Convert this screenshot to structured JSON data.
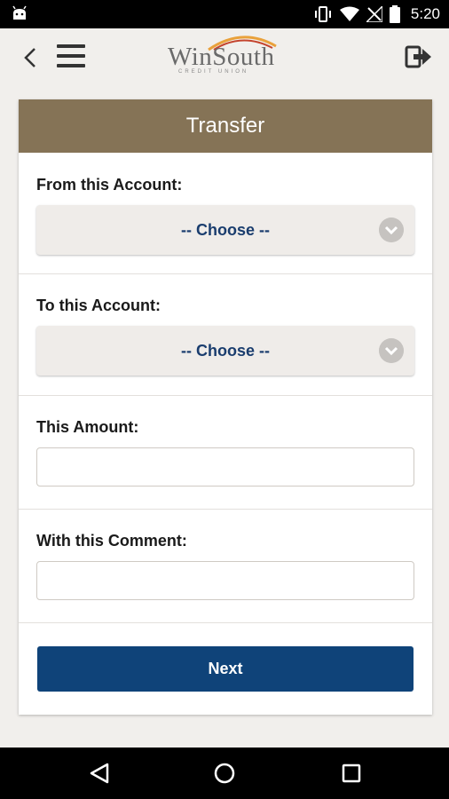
{
  "status_bar": {
    "time": "5:20",
    "icons": [
      "android-debug-icon",
      "vibrate-icon",
      "wifi-icon",
      "no-signal-icon",
      "battery-icon"
    ]
  },
  "app_bar": {
    "logo_text": "WinSouth",
    "logo_subtext": "CREDIT UNION",
    "icons": [
      "back-icon",
      "menu-icon",
      "logout-icon"
    ]
  },
  "transfer": {
    "title": "Transfer",
    "from_label": "From this Account:",
    "from_value": "-- Choose --",
    "to_label": "To this Account:",
    "to_value": "-- Choose --",
    "amount_label": "This Amount:",
    "amount_value": "",
    "comment_label": "With this Comment:",
    "comment_value": "",
    "next_label": "Next"
  },
  "nav_bar": {
    "icons": [
      "nav-back-icon",
      "nav-home-icon",
      "nav-recents-icon"
    ]
  },
  "colors": {
    "header_bg": "#857356",
    "button_bg": "#0f4379",
    "select_text": "#1a3d6e"
  }
}
